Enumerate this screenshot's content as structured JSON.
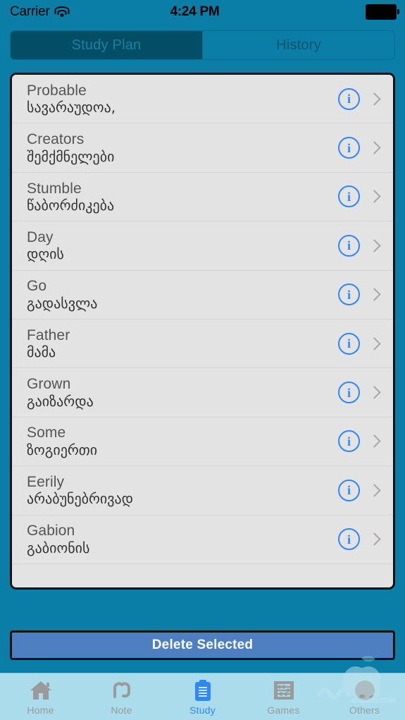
{
  "status_bar": {
    "carrier": "Carrier",
    "wifi_icon": "wifi-icon",
    "time": "4:24 PM",
    "battery_icon": "battery-full-icon"
  },
  "segmented_control": {
    "selected_index": 0,
    "selected_bg": "#034e66",
    "selected_text_color": "#1d7f9e",
    "segments": [
      {
        "label": "Study Plan"
      },
      {
        "label": "History"
      }
    ]
  },
  "list": {
    "info_icon": "info-circle-icon",
    "disclosure_icon": "chevron-right-icon",
    "rows": [
      {
        "english": "Probable",
        "georgian": "სავარაუდოა,"
      },
      {
        "english": "Creators",
        "georgian": "შემქმნელები"
      },
      {
        "english": "Stumble",
        "georgian": "წაბორძიკება"
      },
      {
        "english": "Day",
        "georgian": "დღის"
      },
      {
        "english": "Go",
        "georgian": "გადასვლა"
      },
      {
        "english": "Father",
        "georgian": "მამა"
      },
      {
        "english": "Grown",
        "georgian": "გაიზარდა"
      },
      {
        "english": "Some",
        "georgian": "ზოგიერთი"
      },
      {
        "english": "Eerily",
        "georgian": "არაბუნებრივად"
      },
      {
        "english": "Gabion",
        "georgian": "გაბიონის"
      }
    ]
  },
  "delete_button": {
    "label": "Delete Selected",
    "bg": "#4e7fc0"
  },
  "tab_bar": {
    "active_index": 2,
    "active_color": "#2f87ff",
    "inactive_color": "#9a9a9a",
    "tabs": [
      {
        "label": "Home",
        "icon": "home-icon"
      },
      {
        "label": "Note",
        "icon": "note-icon"
      },
      {
        "label": "Study",
        "icon": "clipboard-icon"
      },
      {
        "label": "Games",
        "icon": "abacus-icon"
      },
      {
        "label": "Others",
        "icon": "circle-half-icon"
      }
    ]
  },
  "theme": {
    "background": "#0a7ea6",
    "list_bg": "#e3e3e3",
    "tab_bar_bg": "#aadcec"
  }
}
